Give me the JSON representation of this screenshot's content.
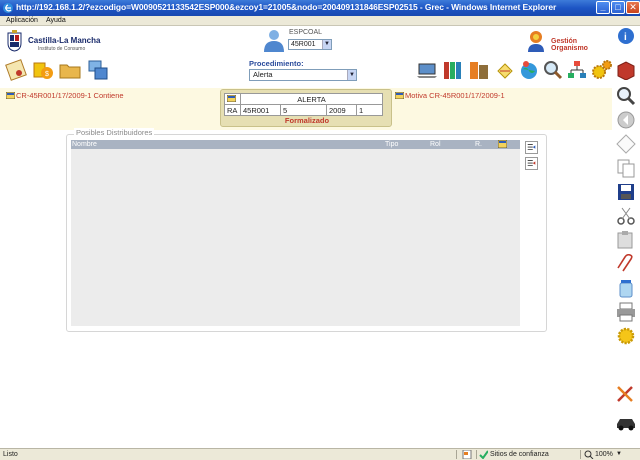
{
  "window": {
    "title": "http://192.168.1.2/?ezcodigo=W0090521133542ESP000&ezcoy1=21005&nodo=200409131846ESP02515 - Grec - Windows Internet Explorer",
    "min_label": "_",
    "max_label": "□",
    "close_label": "✕"
  },
  "menu": {
    "items": [
      "Aplicación",
      "Ayuda"
    ]
  },
  "header": {
    "org_name": "Castilla-La Mancha",
    "org_sub": "Instituto de Consumo",
    "user_code": "ESPCOAL",
    "user_select_value": "45R001",
    "gestion_label": "Gestión Organismo",
    "procedure_label": "Procedimiento:",
    "procedure_value": "Alerta"
  },
  "toolbar_left": [
    "certificate-icon",
    "money-bag-icon",
    "folder-icon",
    "computer-icon"
  ],
  "toolbar_right": [
    "laptop-icon",
    "books-icon",
    "archive-icon",
    "notes-icon",
    "globe-icon",
    "magnifier-icon",
    "hierarchy-icon",
    "gears-icon",
    "book-icon"
  ],
  "sidebar": [
    "search-icon",
    "back-icon",
    "blank-page-icon",
    "copy-icon",
    "save-icon",
    "cut-icon",
    "paste-icon",
    "attach-icon",
    "jar-icon",
    "print-icon",
    "settings-icon",
    "tools-icon",
    "car-icon"
  ],
  "relation": {
    "left": "CR-45R001/17/2009-1 Contiene",
    "right": "Motiva CR-45R001/17/2009-1"
  },
  "record": {
    "title": "ALERTA",
    "type": "RA",
    "code": "45R001",
    "number": "5",
    "year": "2009",
    "version": "1",
    "status": "Formalizado"
  },
  "distributors": {
    "legend": "Posibles Distribuidores",
    "columns": [
      "Nombre",
      "Tipo",
      "Rol",
      "R."
    ],
    "rows": []
  },
  "statusbar": {
    "left": "Listo",
    "zone": "Sitios de confianza",
    "zoom": "100%"
  }
}
